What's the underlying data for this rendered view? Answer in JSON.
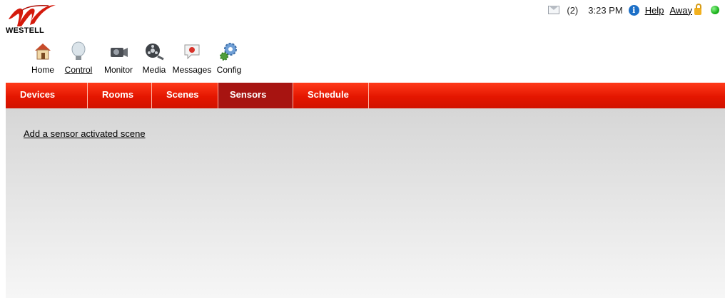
{
  "brand": {
    "logo_text": "WESTELL"
  },
  "status": {
    "message_count": "(2)",
    "time": "3:23 PM",
    "help_label": "Help",
    "away_label": "Away"
  },
  "apps": [
    {
      "label": "Home",
      "icon": "home-icon"
    },
    {
      "label": "Control",
      "icon": "bulb-icon"
    },
    {
      "label": "Monitor",
      "icon": "camera-icon"
    },
    {
      "label": "Media",
      "icon": "film-reel-icon"
    },
    {
      "label": "Messages",
      "icon": "message-icon"
    },
    {
      "label": "Config",
      "icon": "gears-icon"
    }
  ],
  "tabs": [
    {
      "label": "Devices"
    },
    {
      "label": "Rooms"
    },
    {
      "label": "Scenes"
    },
    {
      "label": "Sensors"
    },
    {
      "label": "Schedule"
    }
  ],
  "main": {
    "link_label": "Add a sensor activated scene"
  },
  "colors": {
    "tab_bar": "#e41600",
    "tab_active": "#a71411",
    "online": "#1db31d"
  }
}
